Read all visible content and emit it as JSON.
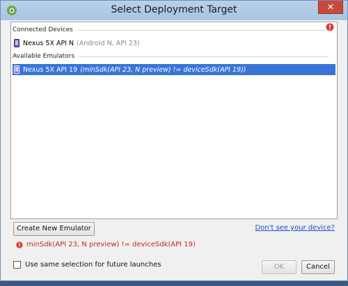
{
  "dialog": {
    "title": "Select Deployment Target",
    "close_label": "✕"
  },
  "sections": {
    "connected_title": "Connected Devices",
    "emulators_title": "Available Emulators"
  },
  "connected_devices": [
    {
      "name": "Nexus 5X API N",
      "detail": "(Android N, API 23)"
    }
  ],
  "available_emulators": [
    {
      "name": "Nexus 5X API 19",
      "note": "(minSdk(API 23, N preview) != deviceSdk(API 19))",
      "selected": true
    }
  ],
  "actions": {
    "create_emulator": "Create New Emulator",
    "dont_see_device": "Don't see your device?"
  },
  "error_message": "minSdk(API 23, N preview) != deviceSdk(API 19)",
  "options": {
    "same_selection_label": "Use same selection for future launches",
    "same_selection_checked": false
  },
  "footer": {
    "ok_label": "OK",
    "cancel_label": "Cancel"
  },
  "colors": {
    "selection": "#3875d7",
    "error": "#c22a1e",
    "link": "#1a4fc7"
  }
}
